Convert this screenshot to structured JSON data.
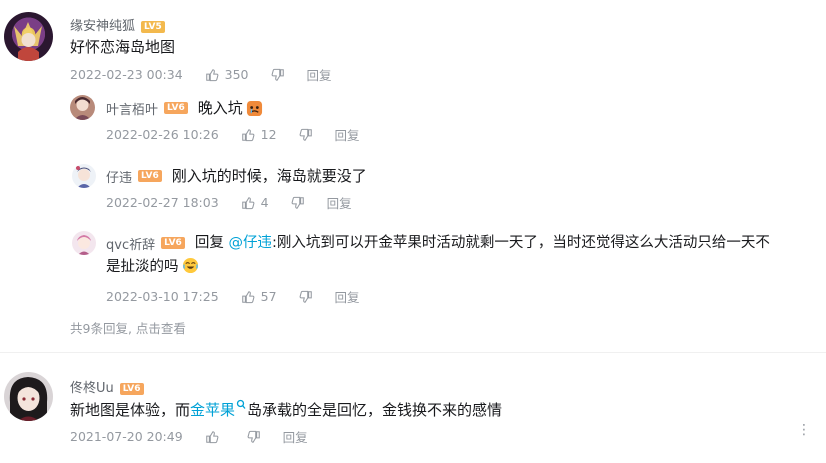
{
  "colors": {
    "link": "#00a1d6",
    "meta": "#9499a0",
    "level_badge": "#f3b94d"
  },
  "comment1": {
    "username": "缘安神纯狐",
    "level": "LV5",
    "text": "好怀恋海岛地图",
    "time": "2022-02-23 00:34",
    "likes": "350",
    "reply_label": "回复",
    "replies": [
      {
        "username": "叶言栢叶",
        "level": "LV6",
        "text": "晚入坑",
        "time": "2022-02-26 10:26",
        "likes": "12",
        "reply_label": "回复"
      },
      {
        "username": "仔违",
        "level": "LV6",
        "text": "刚入坑的时候，海岛就要没了",
        "time": "2022-02-27 18:03",
        "likes": "4",
        "reply_label": "回复"
      },
      {
        "username": "qvc祈辞",
        "level": "LV6",
        "prefix": "回复",
        "mention": "@仔违",
        "text_line1": ":刚入坑到可以开金苹果时活动就剩一天了，当时还觉得这么大活动只给一天不",
        "text_line2": "是扯淡的吗",
        "time": "2022-03-10 17:25",
        "likes": "57",
        "reply_label": "回复"
      }
    ],
    "more_replies": "共9条回复, 点击查看"
  },
  "comment2": {
    "username": "佟柊Uu",
    "level": "LV6",
    "text_before": "新地图是体验，而",
    "link_text": "金苹果",
    "text_after": "岛承载的全是回忆，金钱换不来的感情",
    "time": "2021-07-20 20:49",
    "reply_label": "回复"
  }
}
